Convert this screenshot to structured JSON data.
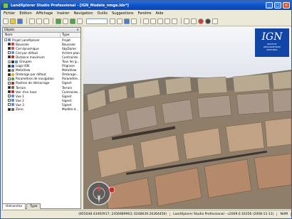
{
  "window": {
    "title": "LandXplorer Studio Professional - [IGN_Modele_nmge.ldx*]",
    "buttons": [
      "_",
      "□",
      "×"
    ]
  },
  "menu": [
    "Fichier",
    "Edition",
    "Affichage",
    "Insérer",
    "Navigation",
    "Outils",
    "Suggestions",
    "Fenêtre",
    "Aide"
  ],
  "toolbar": {
    "combo_value": ""
  },
  "panel": {
    "title": "Objets",
    "close": "×",
    "columns": {
      "name": "Nom",
      "type": "Type"
    },
    "rows": [
      {
        "name": "Projet LandXplorer",
        "type": "Projet",
        "indent": 0,
        "expander": "-",
        "check": false,
        "icon": "#6b8cc8"
      },
      {
        "name": "Boussole",
        "type": "Boussole",
        "indent": 1,
        "check": true,
        "icon": "#c84040"
      },
      {
        "name": "Ciel dynamique",
        "type": "SkyDome",
        "indent": 1,
        "check": true,
        "icon": "#d85050"
      },
      {
        "name": "Ciel par défaut",
        "type": "Arrière-plan",
        "indent": 1,
        "check": false,
        "icon": "#5a9ad8"
      },
      {
        "name": "Distance maximum",
        "type": "Contrainte...",
        "indent": 1,
        "check": true,
        "icon": "#c83030"
      },
      {
        "name": "Groupes",
        "type": "Tous les g...",
        "indent": 1,
        "expander": "+",
        "check": true,
        "icon": "#6a8bd0"
      },
      {
        "name": "Logo IGN",
        "type": "Filigrane",
        "indent": 1,
        "check": true,
        "icon": "#3060b0"
      },
      {
        "name": "MetaView",
        "type": "MetaView",
        "indent": 1,
        "check": true,
        "icon": "#8c8c8c"
      },
      {
        "name": "Ombrage par défaut",
        "type": "Ombrage...",
        "indent": 1,
        "check": true,
        "icon": "#e0b030"
      },
      {
        "name": "Paramètres de navigation",
        "type": "Paramètre...",
        "indent": 1,
        "check": false,
        "icon": "#50a050"
      },
      {
        "name": "Position de démarrage",
        "type": "Signet",
        "indent": 1,
        "check": false,
        "icon": "#b03030"
      },
      {
        "name": "Terrain",
        "type": "Terrain",
        "indent": 1,
        "check": true,
        "icon": "#7a6a40"
      },
      {
        "name": "Voir d'en haut",
        "type": "Contrainte...",
        "indent": 1,
        "check": true,
        "icon": "#c83030"
      },
      {
        "name": "Vue 1",
        "type": "Signet",
        "indent": 1,
        "check": false,
        "icon": "#5a8ad0"
      },
      {
        "name": "Vue 2",
        "type": "Signet",
        "indent": 1,
        "check": false,
        "icon": "#5a8ad0"
      },
      {
        "name": "Vue 3",
        "type": "Signet",
        "indent": 1,
        "check": false,
        "icon": "#5a8ad0"
      },
      {
        "name": "Zone",
        "type": "Modèle d...",
        "indent": 1,
        "check": true,
        "icon": "#6a6a6a"
      }
    ],
    "tabs": [
      "Hiérarchie",
      "Type"
    ]
  },
  "ign_logo": {
    "letters": "IGN",
    "line1": "INSTITUT",
    "line2": "GÉOGRAPHIQUE",
    "line3": "NATIONAL"
  },
  "status": {
    "coords": "(855048.43492917; 2456989963; 6248639.26364450)",
    "version": "LandXplorer Studio Professional - v2009.0.16356 (2008-11-11)",
    "indicator": "NUM"
  }
}
